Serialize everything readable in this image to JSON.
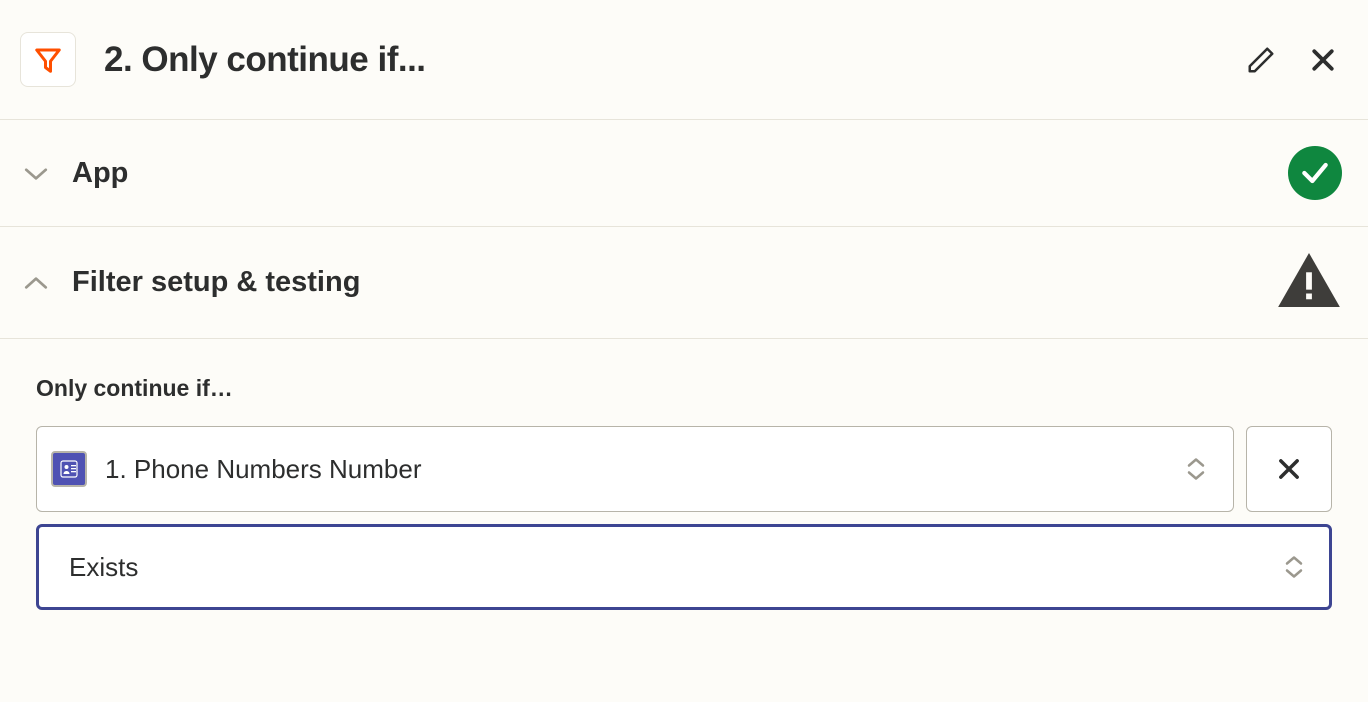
{
  "header": {
    "title": "2. Only continue if..."
  },
  "sections": {
    "app": {
      "label": "App"
    },
    "filter": {
      "label": "Filter setup & testing"
    }
  },
  "filter_body": {
    "label": "Only continue if…",
    "field_value": "1. Phone Numbers Number",
    "condition_value": "Exists"
  }
}
